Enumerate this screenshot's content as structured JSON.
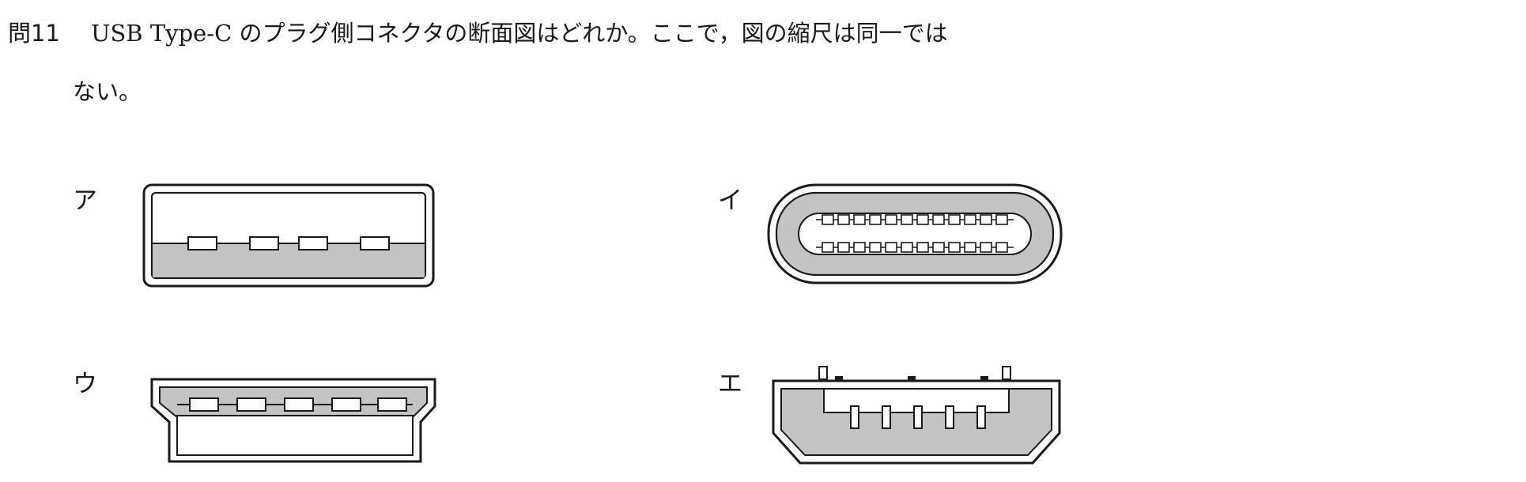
{
  "question": {
    "number": "問11",
    "text_line1": "USB Type-C のプラグ側コネクタの断面図はどれか。ここで，図の縮尺は同一では",
    "text_line2": "ない。"
  },
  "choices": [
    {
      "label": "ア"
    },
    {
      "label": "イ"
    },
    {
      "label": "ウ"
    },
    {
      "label": "エ"
    }
  ],
  "colors": {
    "fill": "#c4c4c4",
    "stroke": "#1a1a1a"
  }
}
